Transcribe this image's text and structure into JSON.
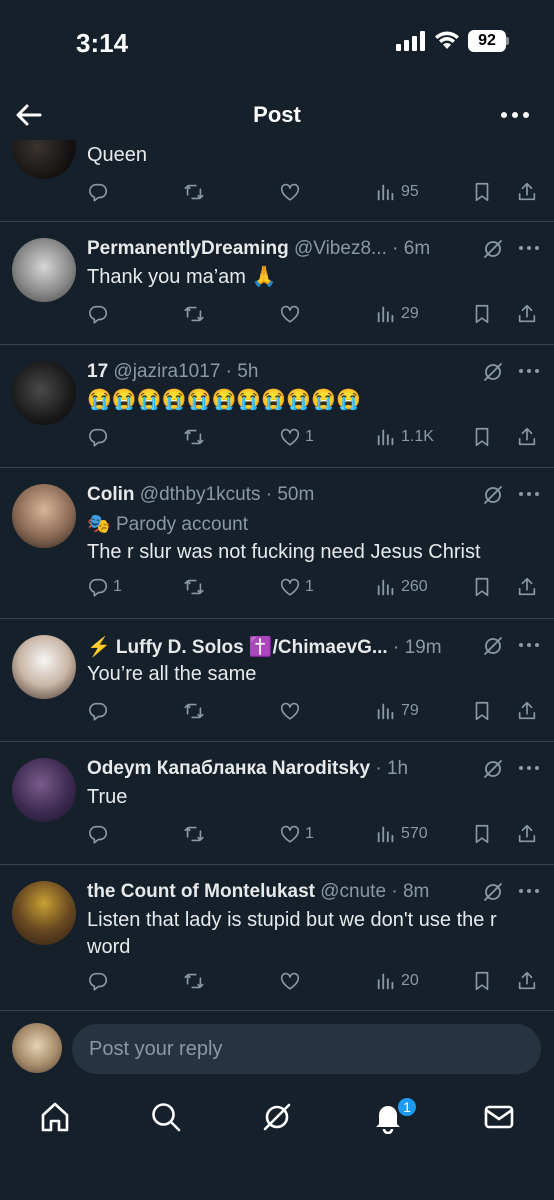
{
  "status_bar": {
    "time": "3:14",
    "battery": "92"
  },
  "header": {
    "title": "Post"
  },
  "tweets": [
    {
      "name": "",
      "handle": "",
      "time": "",
      "text": "Queen",
      "replies": "",
      "likes": "",
      "views": "95"
    },
    {
      "name": "PermanentlyDreaming",
      "handle": "@Vibez8...",
      "time": "6m",
      "text": "Thank you ma’am 🙏",
      "replies": "",
      "likes": "",
      "views": "29"
    },
    {
      "name": "17",
      "handle": "@jazira1017",
      "time": "5h",
      "text": "😭😭😭😭😭😭😭😭😭😭😭",
      "replies": "",
      "likes": "1",
      "views": "1.1K"
    },
    {
      "name": "Colin",
      "handle": "@dthby1kcuts",
      "time": "50m",
      "parody": "Parody account",
      "text": "The r slur was not fucking need Jesus Christ",
      "replies": "1",
      "likes": "1",
      "views": "260"
    },
    {
      "name": "⚡️ Luffy D. Solos ✝️/ChimaevG...",
      "handle": "",
      "time": "19m",
      "text": "You’re all the same",
      "replies": "",
      "likes": "",
      "views": "79"
    },
    {
      "name": "Odeym Капабланка Naroditsky",
      "handle": "",
      "time": "1h",
      "text": "True",
      "replies": "",
      "likes": "1",
      "views": "570"
    },
    {
      "name": "the Count of Montelukast",
      "handle": "@cnute",
      "time": "8m",
      "text": "Listen that lady is stupid but we don't use the r word",
      "replies": "",
      "likes": "",
      "views": "20"
    }
  ],
  "composer": {
    "placeholder": "Post your reply"
  },
  "notifications_badge": "1",
  "colors": {
    "background": "#15202b",
    "muted": "#8b98a5",
    "accent": "#1d9bf0",
    "divider": "#38444d"
  },
  "icons": [
    "back-arrow-icon",
    "more-icon",
    "reply-icon",
    "repost-icon",
    "like-icon",
    "views-icon",
    "bookmark-icon",
    "share-icon",
    "grok-icon",
    "home-icon",
    "search-icon",
    "notifications-icon",
    "messages-icon"
  ]
}
